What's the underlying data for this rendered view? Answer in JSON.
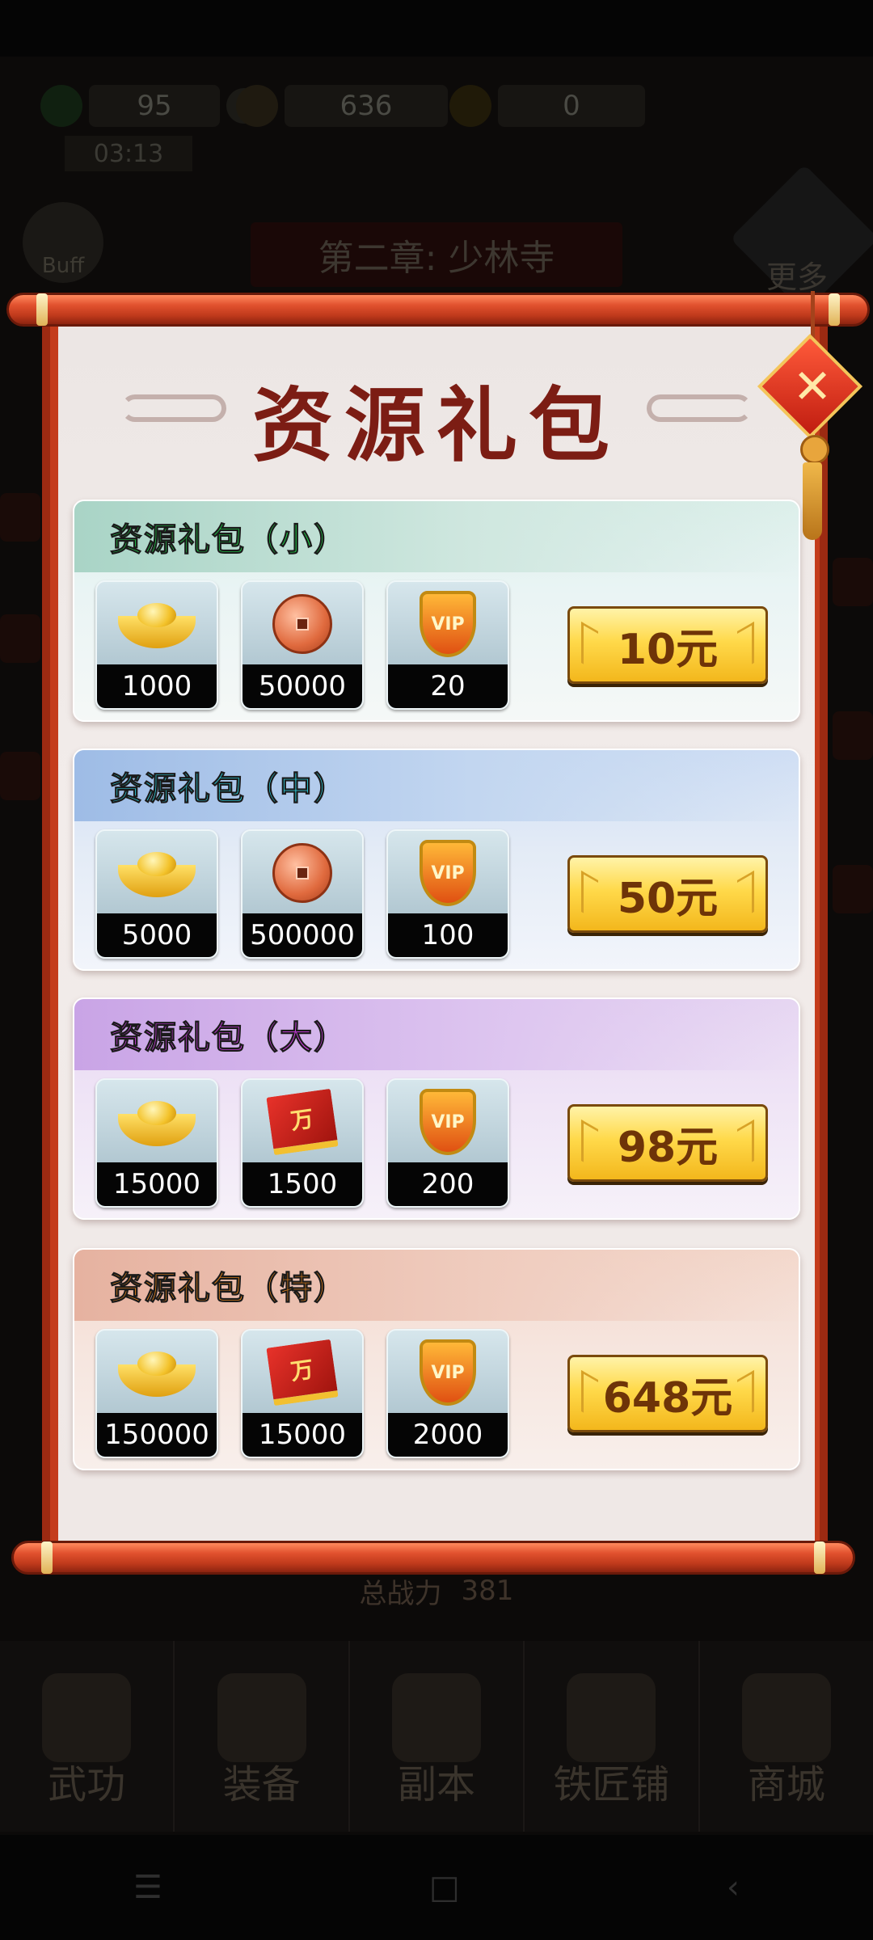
{
  "hud": {
    "stamina": "95",
    "help": "?",
    "coins": "636",
    "gold": "0",
    "timer": "03:13",
    "buff_label": "Buff",
    "chapter": "第二章: 少林寺",
    "more_label": "更多"
  },
  "dialog": {
    "title": "资源礼包",
    "packs": [
      {
        "name": "资源礼包（小）",
        "color": "#1fd04a",
        "price": "10元",
        "items": [
          {
            "icon": "gold-ingot-icon",
            "qty": "1000"
          },
          {
            "icon": "copper-coin-icon",
            "qty": "50000"
          },
          {
            "icon": "vip-shield-icon",
            "label": "VIP",
            "qty": "20"
          }
        ]
      },
      {
        "name": "资源礼包（中）",
        "color": "#2fd8e8",
        "price": "50元",
        "items": [
          {
            "icon": "gold-ingot-icon",
            "qty": "5000"
          },
          {
            "icon": "copper-coin-icon",
            "qty": "500000"
          },
          {
            "icon": "vip-shield-icon",
            "label": "VIP",
            "qty": "100"
          }
        ]
      },
      {
        "name": "资源礼包（大）",
        "color": "#d23ee8",
        "price": "98元",
        "items": [
          {
            "icon": "gold-ingot-icon",
            "qty": "15000"
          },
          {
            "icon": "wan-book-icon",
            "label": "万",
            "qty": "1500"
          },
          {
            "icon": "vip-shield-icon",
            "label": "VIP",
            "qty": "200"
          }
        ]
      },
      {
        "name": "资源礼包（特）",
        "color": "#f58a1a",
        "price": "648元",
        "items": [
          {
            "icon": "gold-ingot-icon",
            "qty": "150000"
          },
          {
            "icon": "wan-book-icon",
            "label": "万",
            "qty": "15000"
          },
          {
            "icon": "vip-shield-icon",
            "label": "VIP",
            "qty": "2000"
          }
        ]
      }
    ]
  },
  "footer": {
    "power_label": "总战力",
    "power_value": "381",
    "nav": [
      "武功",
      "装备",
      "副本",
      "铁匠铺",
      "商城"
    ]
  },
  "system_nav": {
    "menu_icon": "☰",
    "home_icon": "□",
    "back_icon": "‹"
  }
}
